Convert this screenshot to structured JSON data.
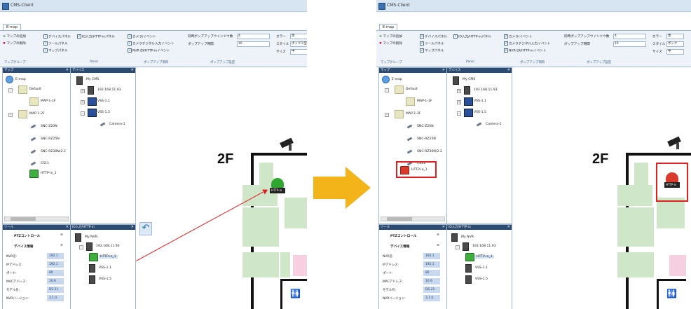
{
  "window_title": "CMS-Client",
  "ribbon_tab": "E-map",
  "ribbon": {
    "map_add": "マップの追加",
    "map_delete": "マップの削除",
    "map_group": "マップグループ",
    "group_label_panel": "Panel",
    "group_label_popup_items": "ポップアップ項目",
    "group_label_popup_settings": "ポップアップ設定",
    "device_panel": "デバイスパネル",
    "io_panel": "IO入力/HTTP-inパネル",
    "tool_panel": "ツールパネル",
    "map_panel": "マップパネル",
    "alarm_event": "カメラ/イベント",
    "camera_digital": "カメラデジタル入力イベント",
    "nvr_http": "NVR DI/HTTP-inイベント",
    "popup_windows": "同時ポップアップウインドウ数",
    "popup_windows_value": "4",
    "popup_time": "ポップアップ時間",
    "popup_time_value": "10",
    "color": "カラー",
    "color_value": "黒",
    "style": "スタイル",
    "style_value_before": "ボックス型",
    "style_value_after": "ボック",
    "size": "サイズ",
    "size_value": "中"
  },
  "map_pane": {
    "title": "マップ",
    "root": "E-map",
    "items": [
      "Default",
      "MAP-1-1F",
      "MAP-1-2F",
      "SNC-Z20N",
      "SNC-RZ25N",
      "SNC-RZ30N(2.2",
      "CS11",
      "HTTP-in_1"
    ]
  },
  "device_pane": {
    "title": "デバイス",
    "root": "My CMS",
    "items": [
      "192.168.11.93",
      "VSS-1.1",
      "VSS-1.5",
      "Camera-1"
    ]
  },
  "tool_pane": {
    "title": "ツール",
    "ptz": "PTZコントロール",
    "device_info": "デバイス情報",
    "props": [
      {
        "k": "NVR名:",
        "v": "192.1"
      },
      {
        "k": "IPアドレス:",
        "v": "192.1"
      },
      {
        "k": "ポート:",
        "v": "80"
      },
      {
        "k": "MACアドレス:",
        "v": "10:6"
      },
      {
        "k": "モデル名:",
        "v": "DS-21"
      },
      {
        "k": "NVRバージョン:",
        "v": "3.1.0."
      }
    ]
  },
  "io_pane": {
    "title": "IO入力/HTTP-in",
    "root": "My NVR",
    "items": [
      "192.168.11.93",
      "HTTP-in_1",
      "VSS-1.1",
      "VSS-1.5"
    ]
  },
  "floor_label": "2F",
  "alarm_label": "HTTP-in",
  "colors": {
    "highlight": "#e02020",
    "arrow": "#f2b418",
    "room_green": "#cfe6c9",
    "room_pink": "#f6cfe0",
    "pane_header": "#2d4a70"
  }
}
